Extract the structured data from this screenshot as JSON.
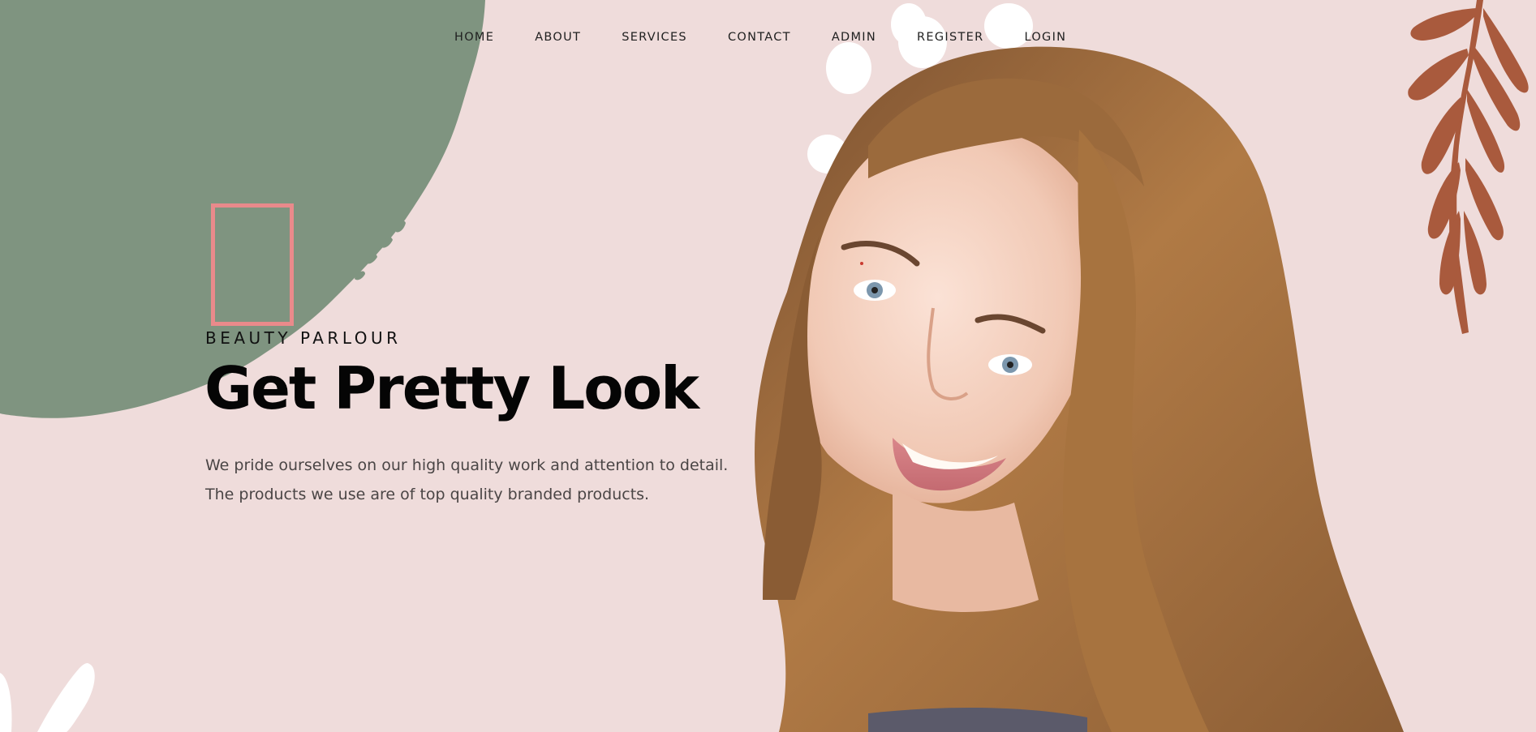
{
  "nav": {
    "items": [
      {
        "label": "HOME"
      },
      {
        "label": "ABOUT"
      },
      {
        "label": "SERVICES"
      },
      {
        "label": "CONTACT"
      },
      {
        "label": "ADMIN"
      },
      {
        "label": "REGISTER"
      },
      {
        "label": "LOGIN"
      }
    ]
  },
  "hero": {
    "eyebrow": "BEAUTY PARLOUR",
    "title": "Get Pretty Look",
    "description_lines": [
      "We pride ourselves on our high quality work and attention to detail.",
      "The products we use are of top quality branded products."
    ]
  },
  "theme": {
    "background": "#efdcdb",
    "green_shape": "#7f9480",
    "leaf_color": "#a95a3d",
    "frame_accent": "#e98a8b",
    "text_dark": "#050505",
    "text_body": "#4a4545"
  },
  "icons": {
    "frame": "outline-rectangle",
    "dots": "white-dots-decoration",
    "leaf": "branch-leaf-decoration"
  }
}
